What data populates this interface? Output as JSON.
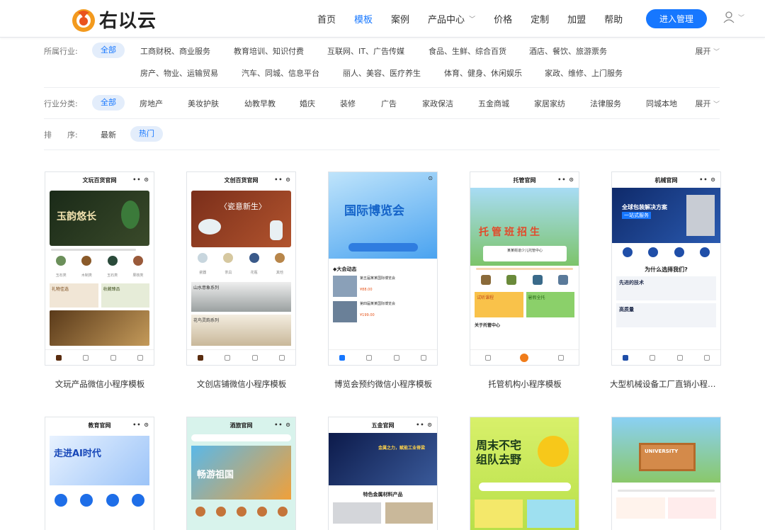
{
  "brand": {
    "name": "右以云"
  },
  "nav": {
    "items": [
      "首页",
      "模板",
      "案例",
      "产品中心",
      "价格",
      "定制",
      "加盟",
      "帮助"
    ],
    "active_index": 1,
    "admin_button": "进入管理"
  },
  "filters": {
    "industry": {
      "label": "所属行业:",
      "all": "全部",
      "options_row1": [
        "工商财税、商业服务",
        "教育培训、知识付费",
        "互联网、IT、广告传媒",
        "食品、生鲜、综合百货",
        "酒店、餐饮、旅游票务"
      ],
      "options_row2": [
        "房产、物业、运输贸易",
        "汽车、同城、信息平台",
        "丽人、美容、医疗养生",
        "体育、健身、休闲娱乐",
        "家政、维修、上门服务"
      ],
      "expand": "展开"
    },
    "category": {
      "label": "行业分类:",
      "all": "全部",
      "options": [
        "房地产",
        "美妆护肤",
        "幼教早教",
        "婚庆",
        "装修",
        "广告",
        "家政保洁",
        "五金商城",
        "家居家纺",
        "法律服务",
        "同城本地"
      ],
      "expand": "展开"
    },
    "sort": {
      "label": "排　　序:",
      "options": [
        "最新",
        "热门"
      ],
      "active_index": 1
    }
  },
  "templates_row1": [
    {
      "header": "文玩百货官网",
      "banner": "玉韵悠长",
      "title": "文玩产品微信小程序模板",
      "icons": [
        "玉石类",
        "木制类",
        "玉石类",
        "果核类"
      ],
      "tiles": [
        "礼物佳选",
        "收藏臻品"
      ]
    },
    {
      "header": "文创百货官网",
      "banner": "〈瓷意新生〉",
      "title": "文创店铺微信小程序模板",
      "icons": [
        "瓷器",
        "茶具",
        "花瓶",
        "其他"
      ],
      "tiles": [
        "山水意象系列",
        "花鸟灵韵系列"
      ]
    },
    {
      "header": "",
      "banner": "国际博览会",
      "title": "博览会预约微信小程序模板",
      "section": "大会动态",
      "items": [
        "第五届某某国际博览会",
        "第四届某某国际博览会"
      ],
      "prices": [
        "¥88.00",
        "¥199.00"
      ]
    },
    {
      "header": "托管官网",
      "banner": "托管班招生",
      "title": "托管机构小程序模板",
      "subtitle": "某某街道少儿托管中心",
      "tiles": [
        "试听课程",
        "暑假全托"
      ],
      "section": "关于托管中心"
    },
    {
      "header": "机械官网",
      "banner": "全球包装解决方案",
      "banner_sub": "一站式服务",
      "title": "大型机械设备工厂直销小程序模板",
      "section": "为什么选择我们?",
      "features": [
        "先进的技术",
        "高质量"
      ]
    }
  ],
  "templates_row2": [
    {
      "header": "教育官网",
      "banner": "走进AI时代"
    },
    {
      "header": "酒旅官网",
      "banner": "畅游祖国"
    },
    {
      "header": "五金官网",
      "banner": "金属之力，赋能工业脊梁",
      "section": "特色金属材料产品"
    },
    {
      "header": "",
      "banner": "周末不宅 组队去野"
    },
    {
      "header": "",
      "banner": "UNIVERSITY"
    }
  ],
  "colors": {
    "accent": "#1677ff",
    "pill_bg": "#e3edfb"
  },
  "icons": {
    "user": "user-icon",
    "chevron": "chevron-down-icon"
  }
}
